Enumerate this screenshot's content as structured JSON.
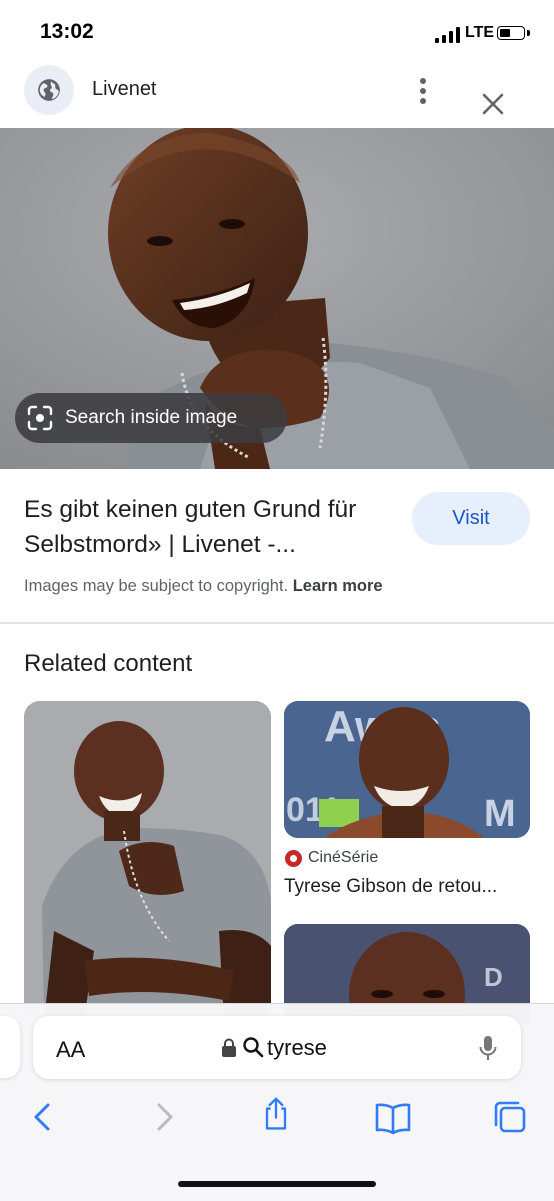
{
  "status": {
    "time": "13:02",
    "network": "LTE"
  },
  "header": {
    "site_name": "Livenet"
  },
  "hero": {
    "chip_label": "Search inside image"
  },
  "result": {
    "title": "Es gibt keinen guten Grund für Selbstmord» | Livenet -...",
    "visit_label": "Visit",
    "copyright_text": "Images may be subject to copyright. ",
    "learn_more": "Learn more"
  },
  "related": {
    "heading": "Related content",
    "cards": [
      {
        "source": "CinéSérie",
        "title": "Tyrese Gibson de retou..."
      }
    ]
  },
  "browser": {
    "aa_label": "AA",
    "url": "tyrese"
  },
  "colors": {
    "accent": "#1a56c7",
    "visit_bg": "#e7effc",
    "chip_bg": "#3c3c40"
  },
  "icons": [
    "globe-icon",
    "more-vert-icon",
    "close-icon",
    "lens-icon",
    "lock-icon",
    "search-icon",
    "mic-icon",
    "back-icon",
    "forward-icon",
    "share-icon",
    "bookmarks-icon",
    "tabs-icon"
  ]
}
